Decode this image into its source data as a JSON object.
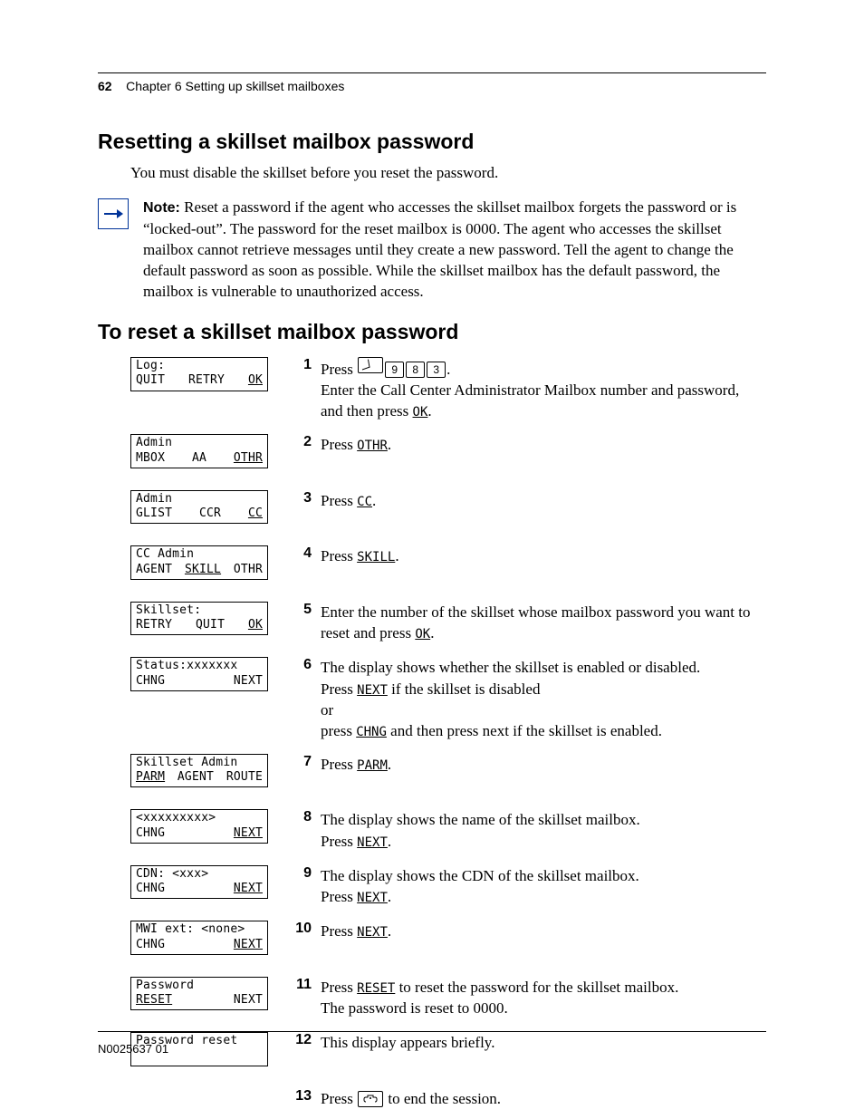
{
  "header": {
    "page_number": "62",
    "chapter": "Chapter 6  Setting up skillset mailboxes"
  },
  "section1": {
    "title": "Resetting a skillset mailbox password",
    "intro": "You must disable the skillset before you reset the password.",
    "note_label": "Note:",
    "note_body": "Reset a password if the agent who accesses the skillset mailbox forgets the password or is “locked-out”. The password for the reset mailbox is 0000. The agent who accesses the skillset mailbox cannot retrieve messages until they create a new password. Tell the agent to change the default password as soon as possible. While the skillset mailbox has the default password, the mailbox is vulnerable to unauthorized access."
  },
  "section2": {
    "title": "To reset a skillset mailbox password"
  },
  "lcds": {
    "s1_l1": "Log:",
    "s1_a": "QUIT",
    "s1_b": "RETRY",
    "s1_c": "OK",
    "s2_l1": "Admin",
    "s2_a": "MBOX",
    "s2_b": "AA",
    "s2_c": "OTHR",
    "s3_l1": "Admin",
    "s3_a": "GLIST",
    "s3_b": "CCR",
    "s3_c": "CC",
    "s4_l1": "CC Admin",
    "s4_a": "AGENT",
    "s4_b": "SKILL",
    "s4_c": "OTHR",
    "s5_l1": "Skillset:",
    "s5_a": "RETRY",
    "s5_b": "QUIT",
    "s5_c": "OK",
    "s6_l1": "Status:xxxxxxx",
    "s6_a": "CHNG",
    "s6_c": "NEXT",
    "s7_l1": "Skillset Admin",
    "s7_a": "PARM",
    "s7_b": "AGENT",
    "s7_c": "ROUTE",
    "s8_l1": "<xxxxxxxxx>",
    "s8_a": "CHNG",
    "s8_c": "NEXT",
    "s9_l1": "CDN: <xxx>",
    "s9_a": "CHNG",
    "s9_c": "NEXT",
    "s10_l1": "MWI ext: <none>",
    "s10_a": "CHNG",
    "s10_c": "NEXT",
    "s11_l1": "Password",
    "s11_a": "RESET",
    "s11_c": "NEXT",
    "s12_l1": "Password reset"
  },
  "steps": {
    "n1": "1",
    "n2": "2",
    "n3": "3",
    "n4": "4",
    "n5": "5",
    "n6": "6",
    "n7": "7",
    "n8": "8",
    "n9": "9",
    "n10": "10",
    "n11": "11",
    "n12": "12",
    "n13": "13",
    "s1_press": "Press ",
    "s1_key1": "9",
    "s1_key2": "8",
    "s1_key3": "3",
    "s1_dot": ".",
    "s1_line2": "Enter the Call Center Administrator Mailbox number and password,",
    "s1_line3_pre": "and then press ",
    "s1_ok": "OK",
    "s2_pre": "Press ",
    "s2_soft": "OTHR",
    "s3_pre": "Press ",
    "s3_soft": "CC",
    "s4_pre": "Press ",
    "s4_soft": "SKILL",
    "s5_line1": "Enter the number of the skillset whose mailbox password you want to reset and press ",
    "s5_ok": "OK",
    "s6_line1": "The display shows whether the skillset is enabled or disabled.",
    "s6_line2_pre": "Press ",
    "s6_next": "NEXT",
    "s6_line2_post": " if the skillset is disabled",
    "s6_or": "or",
    "s6_line3_pre": "press ",
    "s6_chng": "CHNG",
    "s6_line3_post": " and then press next if the skillset is enabled.",
    "s7_pre": "Press ",
    "s7_soft": "PARM",
    "s8_line1": "The display shows the name of the skillset mailbox.",
    "s8_pre": "Press ",
    "s8_next": "NEXT",
    "s9_line1": "The display shows the CDN of the skillset mailbox.",
    "s9_pre": "Press ",
    "s9_next": "NEXT",
    "s10_pre": "Press ",
    "s10_next": "NEXT",
    "s11_pre": "Press ",
    "s11_reset": "RESET",
    "s11_post": " to reset the password for the skillset mailbox.",
    "s11_line2": "The password is reset to 0000.",
    "s12_line": "This display appears briefly.",
    "s13_pre": "Press ",
    "s13_post": " to end the session.",
    "dot": "."
  },
  "footer": {
    "docnum": "N0025637 01"
  }
}
